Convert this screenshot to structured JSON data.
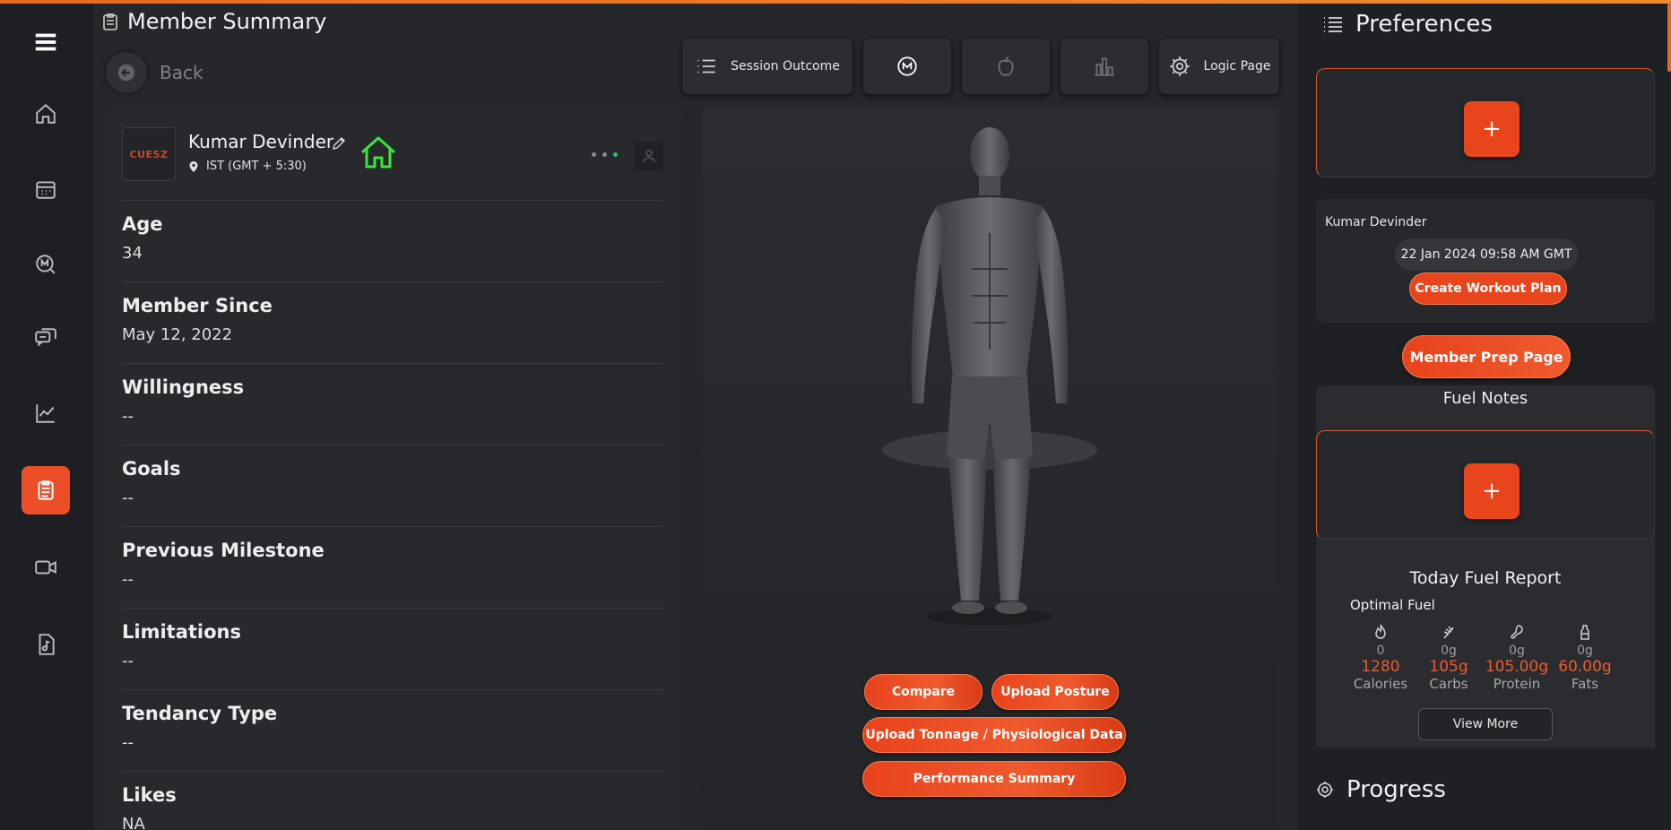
{
  "header": {
    "title": "Member Summary",
    "back_label": "Back"
  },
  "toolbar": {
    "session_outcome_label": "Session Outcome",
    "logic_page_label": "Logic Page"
  },
  "profile": {
    "logo_text": "CUESZ",
    "name": "Kumar Devinder",
    "timezone": "IST (GMT + 5:30)",
    "fields": [
      {
        "label": "Age",
        "value": "34"
      },
      {
        "label": "Member Since",
        "value": "May 12, 2022"
      },
      {
        "label": "Willingness",
        "value": "--"
      },
      {
        "label": "Goals",
        "value": "--"
      },
      {
        "label": "Previous Milestone",
        "value": "--"
      },
      {
        "label": "Limitations",
        "value": "--"
      },
      {
        "label": "Tendancy Type",
        "value": "--"
      },
      {
        "label": "Likes",
        "value": "NA"
      }
    ]
  },
  "actions": {
    "compare": "Compare",
    "upload_posture": "Upload Posture",
    "upload_tonnage": "Upload Tonnage / Physiological Data",
    "performance_summary": "Performance Summary"
  },
  "preferences": {
    "title": "Preferences",
    "add_symbol": "+",
    "plan": {
      "name": "Kumar Devinder",
      "date": "22 Jan 2024 09:58 AM GMT",
      "create_label": "Create Workout Plan"
    },
    "prep_label": "Member Prep Page",
    "fuel_notes_title": "Fuel Notes",
    "report_title": "Today Fuel Report",
    "optimal_label": "Optimal Fuel",
    "macros": [
      {
        "icon": "flame-icon",
        "current": "0",
        "target": "1280",
        "name": "Calories"
      },
      {
        "icon": "wheat-icon",
        "current": "0g",
        "target": "105g",
        "name": "Carbs"
      },
      {
        "icon": "drumstick-icon",
        "current": "0g",
        "target": "105.00g",
        "name": "Protein"
      },
      {
        "icon": "oil-bottle-icon",
        "current": "0g",
        "target": "60.00g",
        "name": "Fats"
      }
    ],
    "view_more_label": "View More",
    "progress_title": "Progress"
  },
  "colors": {
    "accent": "#e8451d",
    "background": "#25272b",
    "sidebar": "#1d1f22",
    "status_online": "#22c55e"
  }
}
